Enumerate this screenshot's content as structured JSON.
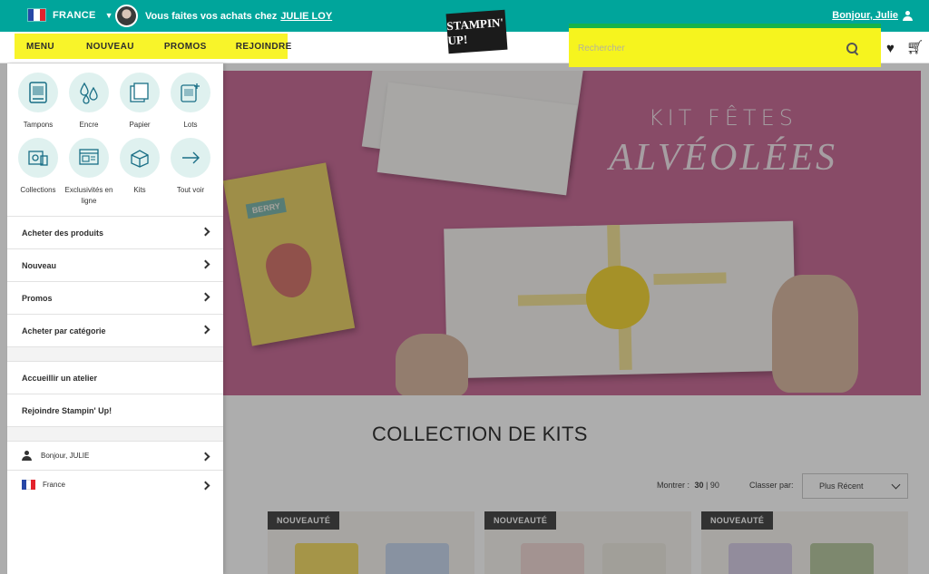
{
  "topbar": {
    "country": "FRANCE",
    "shopping_with_prefix": "Vous faites vos achats chez",
    "demonstrator_name": "JULIE LOY",
    "greeting": "Bonjour, Julie"
  },
  "colors": {
    "teal": "#00a59b",
    "highlight_yellow": "#f8f42a",
    "highlight_green": "#16b34a",
    "flag_blue": "#2747a6",
    "flag_red": "#e3232c"
  },
  "mainnav": {
    "items": [
      "MENU",
      "NOUVEAU",
      "PROMOS",
      "REJOINDRE"
    ]
  },
  "logo": {
    "text": "STAMPIN' UP!"
  },
  "search": {
    "placeholder": "Rechercher"
  },
  "hero": {
    "title_line1": "KIT FÊTES",
    "title_line2": "ALVÉOLÉES",
    "card_label": "BERRY"
  },
  "side_menu": {
    "categories": [
      {
        "label": "Tampons",
        "icon": "stamp-icon"
      },
      {
        "label": "Encre",
        "icon": "ink-drops-icon"
      },
      {
        "label": "Papier",
        "icon": "paper-icon"
      },
      {
        "label": "Lots",
        "icon": "bundle-icon"
      },
      {
        "label": "Collections",
        "icon": "collections-icon"
      },
      {
        "label": "Exclusivités en ligne",
        "icon": "online-exclusive-icon"
      },
      {
        "label": "Kits",
        "icon": "kits-box-icon"
      },
      {
        "label": "Tout voir",
        "icon": "arrow-right-icon"
      }
    ],
    "rows": [
      "Acheter des produits",
      "Nouveau",
      "Promos",
      "Acheter par catégorie"
    ],
    "links": [
      "Accueillir un atelier",
      "Rejoindre Stampin' Up!"
    ],
    "account_label": "Bonjour, JULIE",
    "country_label": "France"
  },
  "listing": {
    "title": "COLLECTION DE KITS",
    "show_label": "Montrer :",
    "show_options": [
      "30",
      "90"
    ],
    "sort_label": "Classer par:",
    "sort_value": "Plus Récent",
    "badge": "NOUVEAUTÉ"
  }
}
